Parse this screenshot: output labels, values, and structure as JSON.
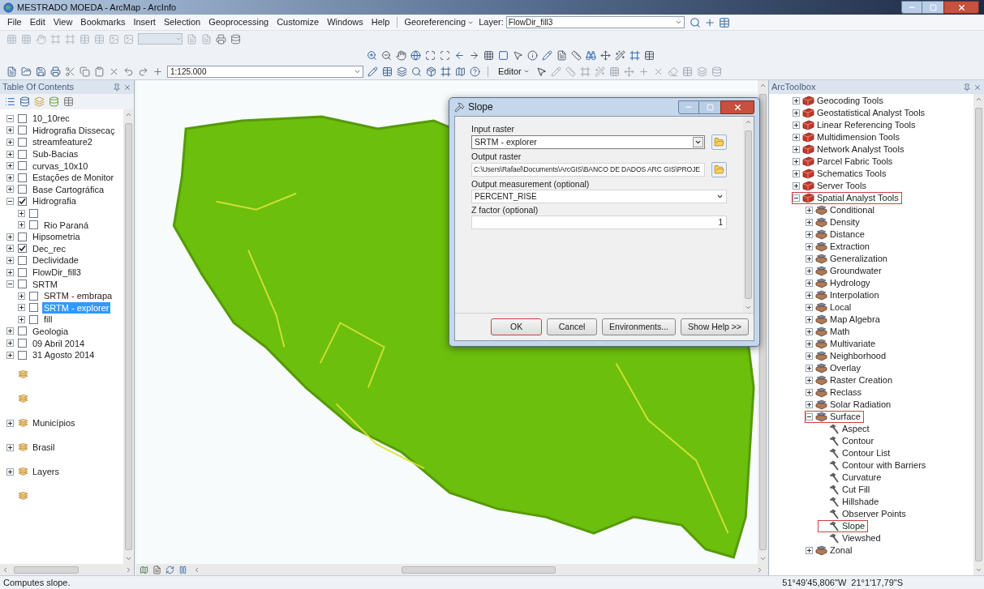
{
  "window": {
    "title": "MESTRADO MOEDA - ArcMap - ArcInfo"
  },
  "menu": [
    "File",
    "Edit",
    "View",
    "Bookmarks",
    "Insert",
    "Selection",
    "Geoprocessing",
    "Customize",
    "Windows",
    "Help"
  ],
  "georef_toolbar": {
    "menu": "Georeferencing",
    "layer_label": "Layer:",
    "layer_value": "FlowDir_fill3"
  },
  "standard_toolbar": {
    "scale": "1:125.000"
  },
  "editor_toolbar": {
    "menu": "Editor"
  },
  "toc": {
    "title": "Table Of Contents",
    "layers": [
      {
        "label": "10_10rec",
        "checked": false,
        "expanded": true,
        "selected": false
      },
      {
        "label": "Hidrografia Dissecaç",
        "checked": false,
        "expanded": false,
        "selected": false
      },
      {
        "label": "streamfeature2",
        "checked": false,
        "expanded": false,
        "selected": false
      },
      {
        "label": "Sub-Bacias",
        "checked": false,
        "expanded": false,
        "selected": false
      },
      {
        "label": "curvas_10x10",
        "checked": false,
        "expanded": false,
        "selected": false
      },
      {
        "label": "Estações de Monitor",
        "checked": false,
        "expanded": false,
        "selected": false
      },
      {
        "label": "Base Cartográfica",
        "checked": false,
        "expanded": false,
        "selected": false
      },
      {
        "label": "Hidrografia",
        "checked": true,
        "expanded": true,
        "selected": false,
        "children": [
          {
            "checked": false,
            "expanded": false,
            "selected": false
          },
          {
            "label": "Rio Paraná",
            "checked": false,
            "expanded": false,
            "selected": false
          }
        ]
      },
      {
        "label": "Hipsometria",
        "checked": false,
        "expanded": false,
        "selected": false
      },
      {
        "label": "Dec_rec",
        "checked": true,
        "expanded": false,
        "selected": false
      },
      {
        "label": "Declividade",
        "checked": false,
        "expanded": false,
        "selected": false
      },
      {
        "label": "FlowDir_fill3",
        "checked": false,
        "expanded": false,
        "selected": false
      },
      {
        "label": "SRTM",
        "checked": false,
        "expanded": true,
        "selected": false,
        "children": [
          {
            "label": "SRTM - embrapa",
            "checked": false,
            "expanded": false,
            "selected": false
          },
          {
            "label": "SRTM - explorer",
            "checked": false,
            "expanded": false,
            "selected": true
          },
          {
            "label": "fill",
            "checked": false,
            "expanded": false,
            "selected": false
          }
        ]
      },
      {
        "label": "Geologia",
        "checked": false,
        "expanded": false,
        "selected": false
      },
      {
        "label": "09 Abril 2014",
        "checked": false,
        "expanded": false,
        "selected": false
      },
      {
        "label": "31 Agosto 2014",
        "checked": false,
        "expanded": false,
        "selected": false
      }
    ],
    "data_frames": [
      {
        "kind": "empty"
      },
      {
        "kind": "empty"
      },
      {
        "kind": "group",
        "label": "Municípios",
        "expanded": false
      },
      {
        "kind": "group",
        "label": "Brasil",
        "expanded": false
      },
      {
        "kind": "group",
        "label": "Layers",
        "expanded": false
      },
      {
        "kind": "empty"
      }
    ]
  },
  "dialog": {
    "title": "Slope",
    "fields": [
      {
        "label": "Input raster",
        "value": "SRTM - explorer",
        "kind": "dropdown",
        "browse": true
      },
      {
        "label": "Output raster",
        "value": "C:\\Users\\Rafael\\Documents\\ArcGIS\\BANCO DE DADOS ARC GIS\\PROJE",
        "kind": "text",
        "browse": true
      },
      {
        "label": "Output measurement (optional)",
        "value": "PERCENT_RISE",
        "kind": "combo",
        "browse": false
      },
      {
        "label": "Z factor (optional)",
        "value": "1",
        "kind": "number",
        "browse": false
      }
    ],
    "buttons": [
      {
        "label": "OK",
        "highlighted": true
      },
      {
        "label": "Cancel",
        "highlighted": false
      },
      {
        "label": "Environments...",
        "highlighted": false
      },
      {
        "label": "Show Help >>",
        "highlighted": false
      }
    ]
  },
  "toolbox": {
    "title": "ArcToolbox",
    "items": [
      {
        "kind": "toolbox",
        "label": "Geocoding Tools",
        "expanded": false,
        "highlighted": false
      },
      {
        "kind": "toolbox",
        "label": "Geostatistical Analyst Tools",
        "expanded": false,
        "highlighted": false
      },
      {
        "kind": "toolbox",
        "label": "Linear Referencing Tools",
        "expanded": false,
        "highlighted": false
      },
      {
        "kind": "toolbox",
        "label": "Multidimension Tools",
        "expanded": false,
        "highlighted": false
      },
      {
        "kind": "toolbox",
        "label": "Network Analyst Tools",
        "expanded": false,
        "highlighted": false
      },
      {
        "kind": "toolbox",
        "label": "Parcel Fabric Tools",
        "expanded": false,
        "highlighted": false
      },
      {
        "kind": "toolbox",
        "label": "Schematics Tools",
        "expanded": false,
        "highlighted": false
      },
      {
        "kind": "toolbox",
        "label": "Server Tools",
        "expanded": false,
        "highlighted": false
      },
      {
        "kind": "toolbox",
        "label": "Spatial Analyst Tools",
        "expanded": true,
        "highlighted": true,
        "children": [
          {
            "kind": "toolset",
            "label": "Conditional",
            "expanded": false,
            "highlighted": false
          },
          {
            "kind": "toolset",
            "label": "Density",
            "expanded": false,
            "highlighted": false
          },
          {
            "kind": "toolset",
            "label": "Distance",
            "expanded": false,
            "highlighted": false
          },
          {
            "kind": "toolset",
            "label": "Extraction",
            "expanded": false,
            "highlighted": false
          },
          {
            "kind": "toolset",
            "label": "Generalization",
            "expanded": false,
            "highlighted": false
          },
          {
            "kind": "toolset",
            "label": "Groundwater",
            "expanded": false,
            "highlighted": false
          },
          {
            "kind": "toolset",
            "label": "Hydrology",
            "expanded": false,
            "highlighted": false
          },
          {
            "kind": "toolset",
            "label": "Interpolation",
            "expanded": false,
            "highlighted": false
          },
          {
            "kind": "toolset",
            "label": "Local",
            "expanded": false,
            "highlighted": false
          },
          {
            "kind": "toolset",
            "label": "Map Algebra",
            "expanded": false,
            "highlighted": false
          },
          {
            "kind": "toolset",
            "label": "Math",
            "expanded": false,
            "highlighted": false
          },
          {
            "kind": "toolset",
            "label": "Multivariate",
            "expanded": false,
            "highlighted": false
          },
          {
            "kind": "toolset",
            "label": "Neighborhood",
            "expanded": false,
            "highlighted": false
          },
          {
            "kind": "toolset",
            "label": "Overlay",
            "expanded": false,
            "highlighted": false
          },
          {
            "kind": "toolset",
            "label": "Raster Creation",
            "expanded": false,
            "highlighted": false
          },
          {
            "kind": "toolset",
            "label": "Reclass",
            "expanded": false,
            "highlighted": false
          },
          {
            "kind": "toolset",
            "label": "Solar Radiation",
            "expanded": false,
            "highlighted": false
          },
          {
            "kind": "toolset",
            "label": "Surface",
            "expanded": true,
            "highlighted": true,
            "children": [
              {
                "kind": "tool",
                "label": "Aspect",
                "highlighted": false
              },
              {
                "kind": "tool",
                "label": "Contour",
                "highlighted": false
              },
              {
                "kind": "tool",
                "label": "Contour List",
                "highlighted": false
              },
              {
                "kind": "tool",
                "label": "Contour with Barriers",
                "highlighted": false
              },
              {
                "kind": "tool",
                "label": "Curvature",
                "highlighted": false
              },
              {
                "kind": "tool",
                "label": "Cut Fill",
                "highlighted": false
              },
              {
                "kind": "tool",
                "label": "Hillshade",
                "highlighted": false
              },
              {
                "kind": "tool",
                "label": "Observer Points",
                "highlighted": false
              },
              {
                "kind": "tool",
                "label": "Slope",
                "highlighted": true
              },
              {
                "kind": "tool",
                "label": "Viewshed",
                "highlighted": false
              }
            ]
          },
          {
            "kind": "toolset",
            "label": "Zonal",
            "expanded": false,
            "highlighted": false
          }
        ]
      }
    ]
  },
  "status_bar": {
    "message": "Computes slope.",
    "coordinates": "51°49'45,806\"W  21°1'17,79\"S"
  }
}
